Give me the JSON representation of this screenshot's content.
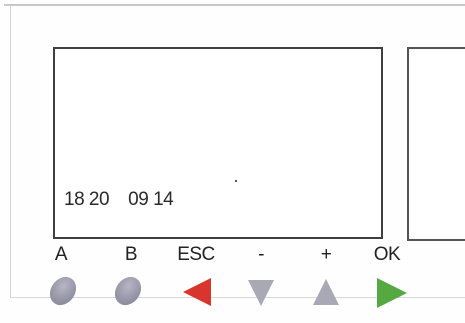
{
  "screen": {
    "readout": "18 20    09 14"
  },
  "buttons": [
    {
      "label": "A",
      "icon": "oval-button-icon",
      "color": "#9596a6"
    },
    {
      "label": "B",
      "icon": "oval-button-icon",
      "color": "#9596a6"
    },
    {
      "label": "ESC",
      "icon": "left-arrow-icon",
      "color": "#d8352c"
    },
    {
      "label": "-",
      "icon": "down-arrow-icon",
      "color": "#a8a9b5"
    },
    {
      "label": "+",
      "icon": "up-arrow-icon",
      "color": "#a8a9b5"
    },
    {
      "label": "OK",
      "icon": "right-arrow-icon",
      "color": "#56a842"
    }
  ]
}
